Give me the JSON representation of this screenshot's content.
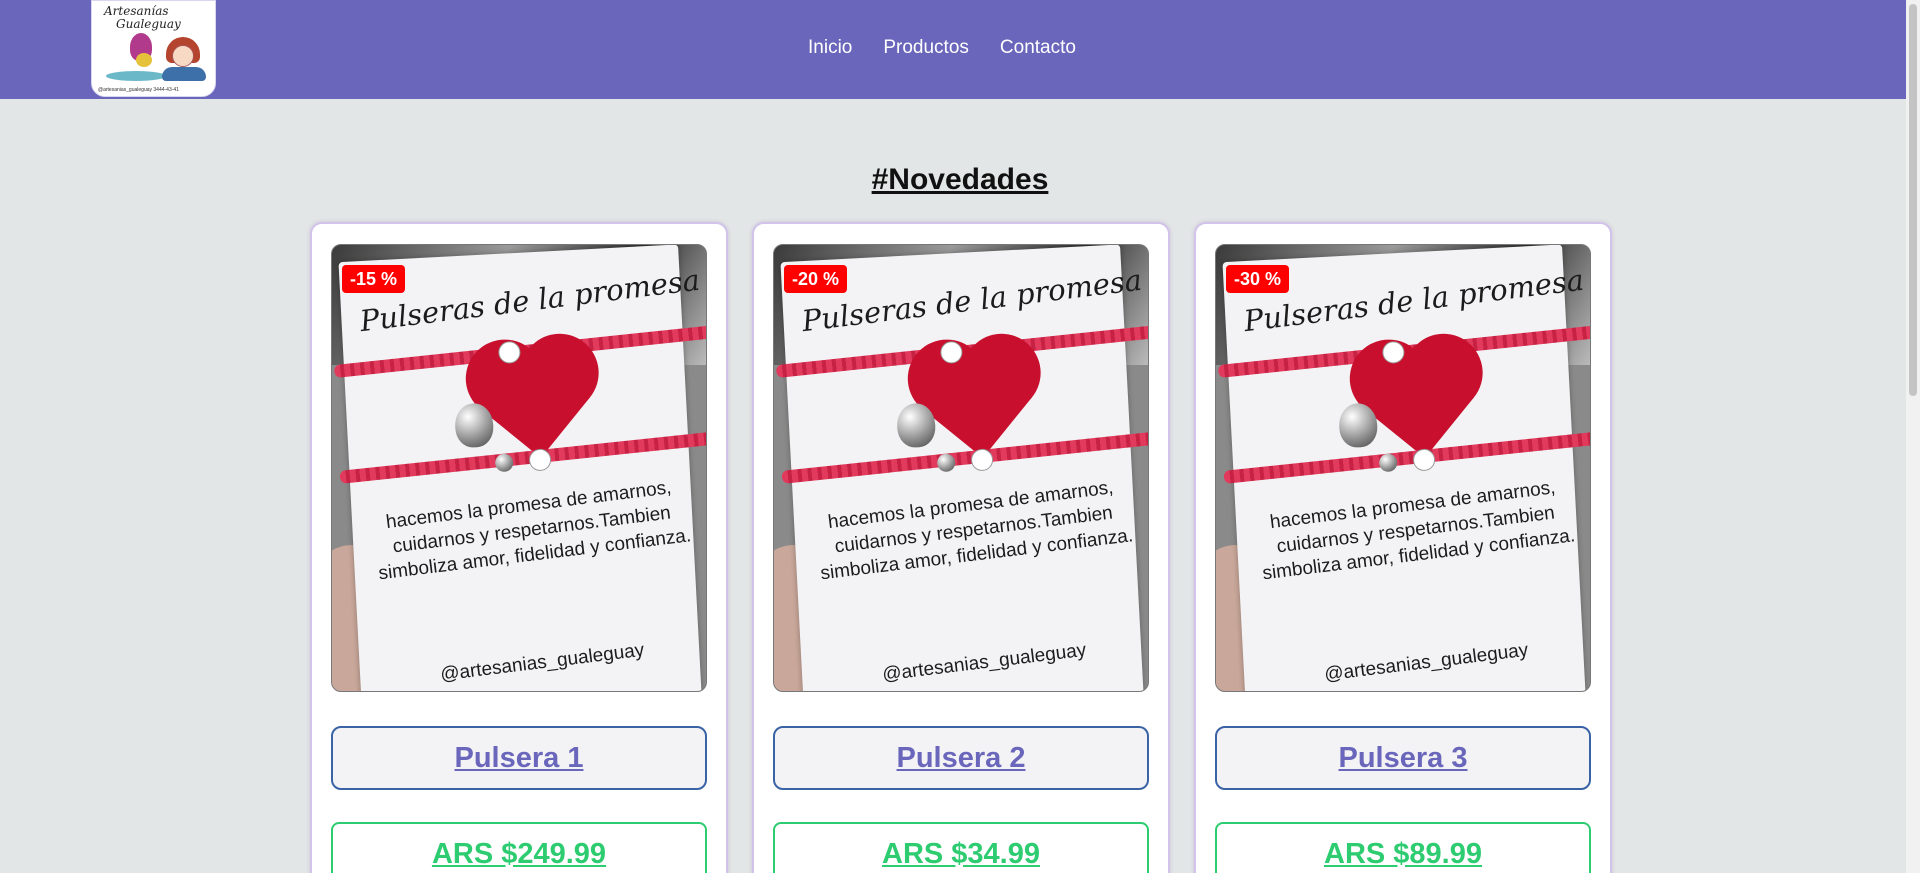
{
  "header": {
    "logo": {
      "text_line1": "Artesanías",
      "text_line2": "Gualeguay",
      "footer": "@artesanias_gualeguay    3444-43-41"
    },
    "nav": [
      {
        "label": "Inicio"
      },
      {
        "label": "Productos"
      },
      {
        "label": "Contacto"
      }
    ]
  },
  "main": {
    "section_title": "#Novedades",
    "product_image": {
      "title": "Pulseras de la promesa",
      "text": "hacemos la promesa de amarnos, cuidarnos y respetarnos.Tambien simboliza amor, fidelidad y confianza.",
      "handle": "@artesanias_gualeguay"
    },
    "products": [
      {
        "badge": "-15 %",
        "name": "Pulsera 1",
        "price": "ARS $249.99"
      },
      {
        "badge": "-20 %",
        "name": "Pulsera 2",
        "price": "ARS $34.99"
      },
      {
        "badge": "-30 %",
        "name": "Pulsera 3",
        "price": "ARS $89.99"
      }
    ]
  },
  "colors": {
    "navbar": "#6a66bb",
    "background": "#e3e6e6",
    "badge": "#ff0000",
    "product_name": "#6a66bb",
    "price": "#2ecc71"
  }
}
